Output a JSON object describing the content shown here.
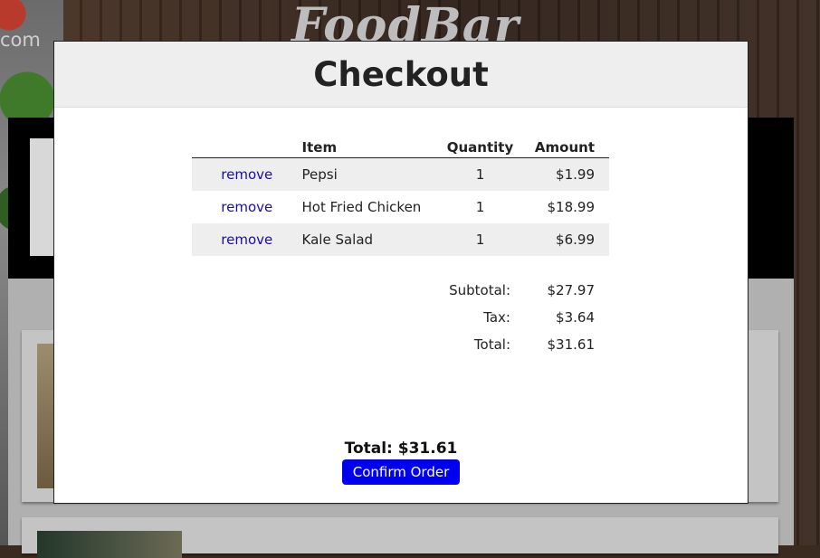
{
  "background": {
    "brand": "FoodBar",
    "url_fragment": "com"
  },
  "modal": {
    "title": "Checkout",
    "columns": [
      "",
      "Item",
      "Quantity",
      "Amount"
    ],
    "items": [
      {
        "action": "remove",
        "name": "Pepsi",
        "quantity": "1",
        "amount": "$1.99"
      },
      {
        "action": "remove",
        "name": "Hot Fried Chicken",
        "quantity": "1",
        "amount": "$18.99"
      },
      {
        "action": "remove",
        "name": "Kale Salad",
        "quantity": "1",
        "amount": "$6.99"
      }
    ],
    "summary": {
      "subtotal_label": "Subtotal:",
      "subtotal_value": "$27.97",
      "tax_label": "Tax:",
      "tax_value": "$3.64",
      "total_label": "Total:",
      "total_value": "$31.61"
    },
    "footer_total": "Total: $31.61",
    "confirm_label": "Confirm Order"
  },
  "colors": {
    "confirm_button": "#0000ee",
    "remove_link": "#1a0dab",
    "header_bg": "#eeeeee"
  }
}
